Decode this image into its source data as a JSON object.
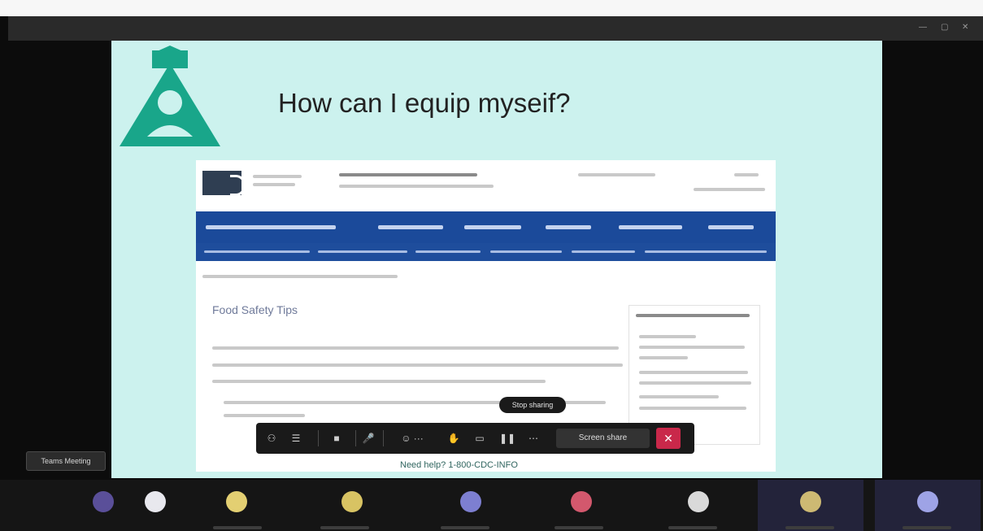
{
  "slide": {
    "title": "How can I equip myseif?",
    "caption": "Need help? 1-800-CDC-INFO"
  },
  "embedded_page": {
    "heading": "Food Safety Tips"
  },
  "share_toolbar": {
    "tooltip": "Stop sharing",
    "share_label": "Screen share",
    "stop_label": "✕"
  },
  "participant": {
    "name": "Teams Meeting"
  },
  "colors": {
    "slide_bg": "#ccf2ee",
    "logo_green": "#19a68a",
    "nav_blue": "#1b4a9a",
    "stop_red": "#c9284a"
  },
  "gallery": {
    "avatars": [
      {
        "icon": "participant-avatar-icon",
        "color": "#5a4f99"
      },
      {
        "icon": "participant-avatar-icon",
        "color": "#e8e8ee"
      },
      {
        "icon": "participant-avatar-icon",
        "color": "#e3cf72"
      },
      {
        "icon": "participant-avatar-icon",
        "color": "#d8c363"
      },
      {
        "icon": "participant-avatar-icon",
        "color": "#7d7fd1"
      },
      {
        "icon": "participant-avatar-icon",
        "color": "#d3586d"
      },
      {
        "icon": "participant-avatar-icon",
        "color": "#d9d9d9"
      },
      {
        "icon": "participant-avatar-icon",
        "color": "#cdb973"
      },
      {
        "icon": "participant-avatar-icon",
        "color": "#9ea3e6"
      }
    ]
  }
}
